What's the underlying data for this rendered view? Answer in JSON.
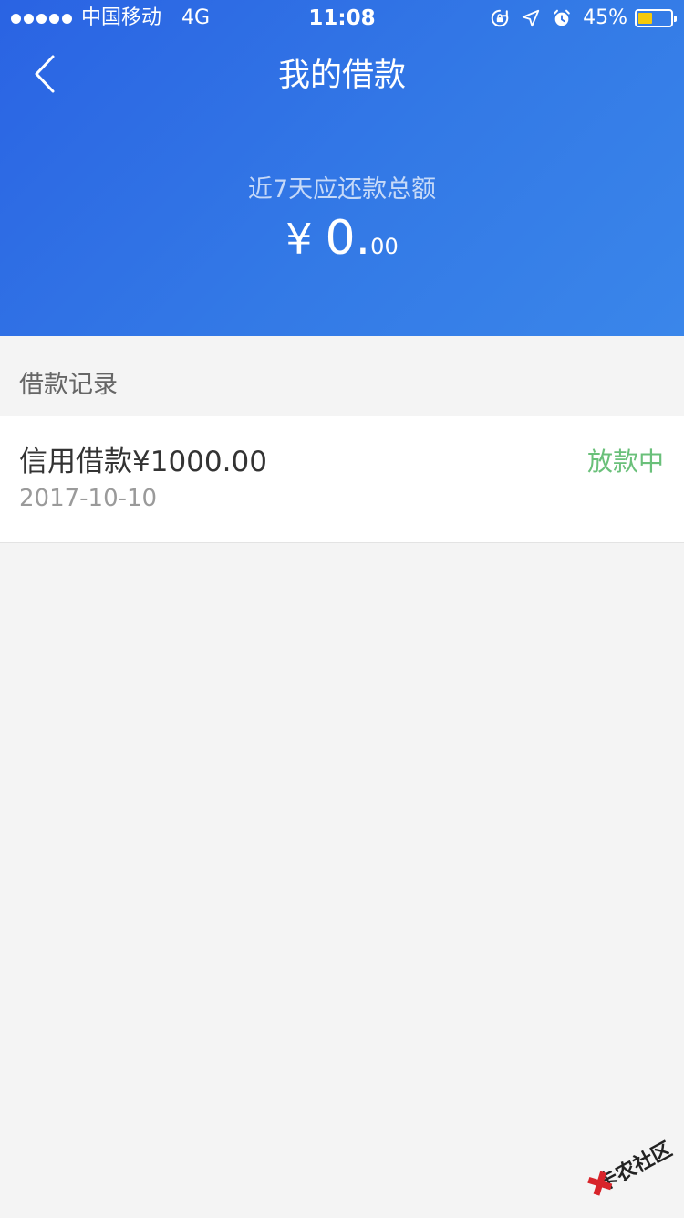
{
  "status_bar": {
    "carrier": "中国移动",
    "network": "4G",
    "time": "11:08",
    "battery": "45%",
    "battery_level": 0.45,
    "icons": [
      "rotation-lock-icon",
      "location-icon",
      "alarm-icon",
      "battery-icon"
    ]
  },
  "header": {
    "title": "我的借款",
    "back_icon": "chevron-left-icon",
    "summary_label": "近7天应还款总额",
    "amount_currency": "¥",
    "amount_integer": "0.",
    "amount_decimals": "00"
  },
  "records": {
    "section_title": "借款记录",
    "items": [
      {
        "title": "信用借款¥1000.00",
        "date": "2017-10-10",
        "status": "放款中"
      }
    ]
  },
  "watermark": {
    "text": "卡农社区"
  },
  "colors": {
    "header_start": "#2a63e3",
    "header_end": "#3a86ea",
    "status_green": "#6ac07a",
    "background": "#f4f4f4",
    "battery_yellow": "#f6c90b"
  }
}
